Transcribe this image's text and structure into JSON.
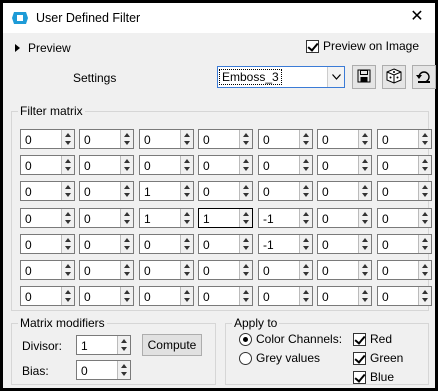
{
  "window": {
    "title": "User Defined Filter",
    "close_glyph": "✕"
  },
  "top": {
    "preview_label": "Preview",
    "preview_on_image_label": "Preview on Image",
    "preview_on_image_checked": true,
    "settings_label": "Settings",
    "settings_value": "Emboss_3"
  },
  "filter_matrix": {
    "title": "Filter matrix",
    "rows": [
      [
        "0",
        "0",
        "0",
        "0",
        "0",
        "0",
        "0"
      ],
      [
        "0",
        "0",
        "0",
        "0",
        "0",
        "0",
        "0"
      ],
      [
        "0",
        "0",
        "1",
        "0",
        "0",
        "0",
        "0"
      ],
      [
        "0",
        "0",
        "1",
        "1",
        "-1",
        "0",
        "0"
      ],
      [
        "0",
        "0",
        "0",
        "0",
        "-1",
        "0",
        "0"
      ],
      [
        "0",
        "0",
        "0",
        "0",
        "0",
        "0",
        "0"
      ],
      [
        "0",
        "0",
        "0",
        "0",
        "0",
        "0",
        "0"
      ]
    ]
  },
  "matrix_modifiers": {
    "title": "Matrix modifiers",
    "divisor_label": "Divisor:",
    "divisor_value": "1",
    "bias_label": "Bias:",
    "bias_value": "0",
    "compute_label": "Compute"
  },
  "apply_to": {
    "title": "Apply to",
    "color_channels_label": "Color Channels:",
    "grey_values_label": "Grey values",
    "red_label": "Red",
    "green_label": "Green",
    "blue_label": "Blue"
  }
}
